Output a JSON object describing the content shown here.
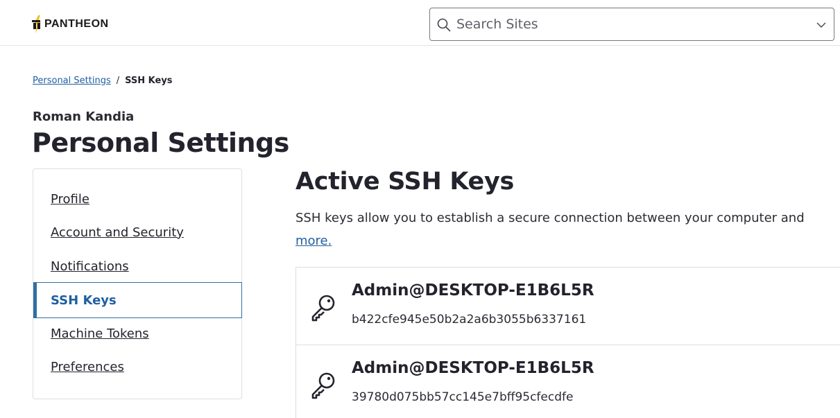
{
  "header": {
    "logo_text": "PANTHEON",
    "search": {
      "placeholder": "Search Sites",
      "value": ""
    },
    "icons": {
      "search": "search-icon",
      "dropdown": "chevron-down-icon"
    }
  },
  "breadcrumb": {
    "parent": "Personal Settings",
    "separator": "/",
    "current": "SSH Keys"
  },
  "user": {
    "name": "Roman Kandia"
  },
  "page_title": "Personal Settings",
  "sidebar": {
    "items": [
      {
        "label": "Profile",
        "active": false
      },
      {
        "label": "Account and Security",
        "active": false
      },
      {
        "label": "Notifications",
        "active": false
      },
      {
        "label": "SSH Keys",
        "active": true
      },
      {
        "label": "Machine Tokens",
        "active": false
      },
      {
        "label": "Preferences",
        "active": false
      }
    ]
  },
  "main": {
    "title": "Active SSH Keys",
    "description": "SSH keys allow you to establish a secure connection between your computer and",
    "learn_more": "more.",
    "keys": [
      {
        "name": "Admin@DESKTOP-E1B6L5R",
        "fingerprint": "b422cfe945e50b2a2a6b3055b6337161",
        "icon": "key-icon"
      },
      {
        "name": "Admin@DESKTOP-E1B6L5R",
        "fingerprint": "39780d075bb57cc145e7bff95cfecdfe",
        "icon": "key-icon"
      }
    ]
  },
  "colors": {
    "accent": "#1f5fa0",
    "active_border": "#2f6fa3",
    "logo_yellow": "#f4c322",
    "text": "#23232d",
    "border": "#dedee2"
  }
}
